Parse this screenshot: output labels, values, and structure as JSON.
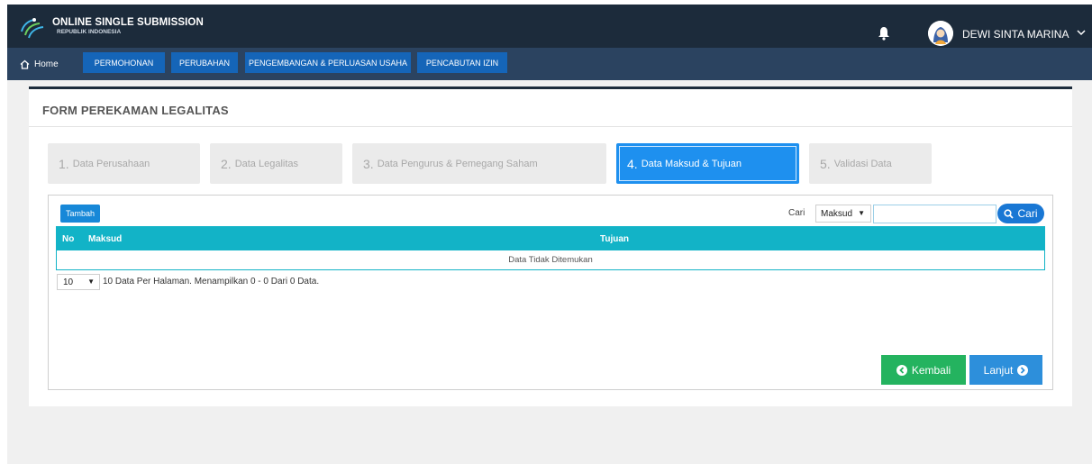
{
  "header": {
    "brand_title": "ONLINE SINGLE SUBMISSION",
    "brand_subtitle": "REPUBLIK INDONESIA",
    "user_name": "DEWI SINTA MARINA"
  },
  "nav": {
    "home": "Home",
    "items": [
      {
        "label": "PERMOHONAN"
      },
      {
        "label": "PERUBAHAN"
      },
      {
        "label": "PENGEMBANGAN & PERLUASAN USAHA"
      },
      {
        "label": "PENCABUTAN IZIN"
      }
    ]
  },
  "form": {
    "title": "FORM PEREKAMAN LEGALITAS",
    "steps": [
      {
        "num": "1.",
        "label": "Data Perusahaan"
      },
      {
        "num": "2.",
        "label": "Data Legalitas"
      },
      {
        "num": "3.",
        "label": "Data Pengurus & Pemegang Saham"
      },
      {
        "num": "4.",
        "label": "Data Maksud & Tujuan",
        "active": true
      },
      {
        "num": "5.",
        "label": "Validasi Data"
      }
    ]
  },
  "panel": {
    "add_label": "Tambah",
    "search_label": "Cari",
    "search_field": "Maksud",
    "search_value": "",
    "search_button": "Cari",
    "table": {
      "columns": [
        "No",
        "Maksud",
        "Tujuan"
      ],
      "empty_message": "Data Tidak Ditemukan",
      "rows": []
    },
    "per_page": "10",
    "pagination_info": "10 Data Per Halaman. Menampilkan 0 - 0 Dari 0 Data.",
    "back_label": "Kembali",
    "next_label": "Lanjut"
  },
  "colors": {
    "header_bg": "#1c2b3b",
    "nav_bg": "#2b4360",
    "nav_button": "#1565b8",
    "active_step": "#1e90ef",
    "table_header": "#12b3c7",
    "back_button": "#24b35f",
    "next_button": "#2d8fdb"
  },
  "icons": {
    "logo": "oss-logo",
    "notification": "bell-icon",
    "user": "avatar",
    "home": "home-icon",
    "search": "search-icon",
    "back": "arrow-left-circle-icon",
    "next": "arrow-right-circle-icon"
  }
}
